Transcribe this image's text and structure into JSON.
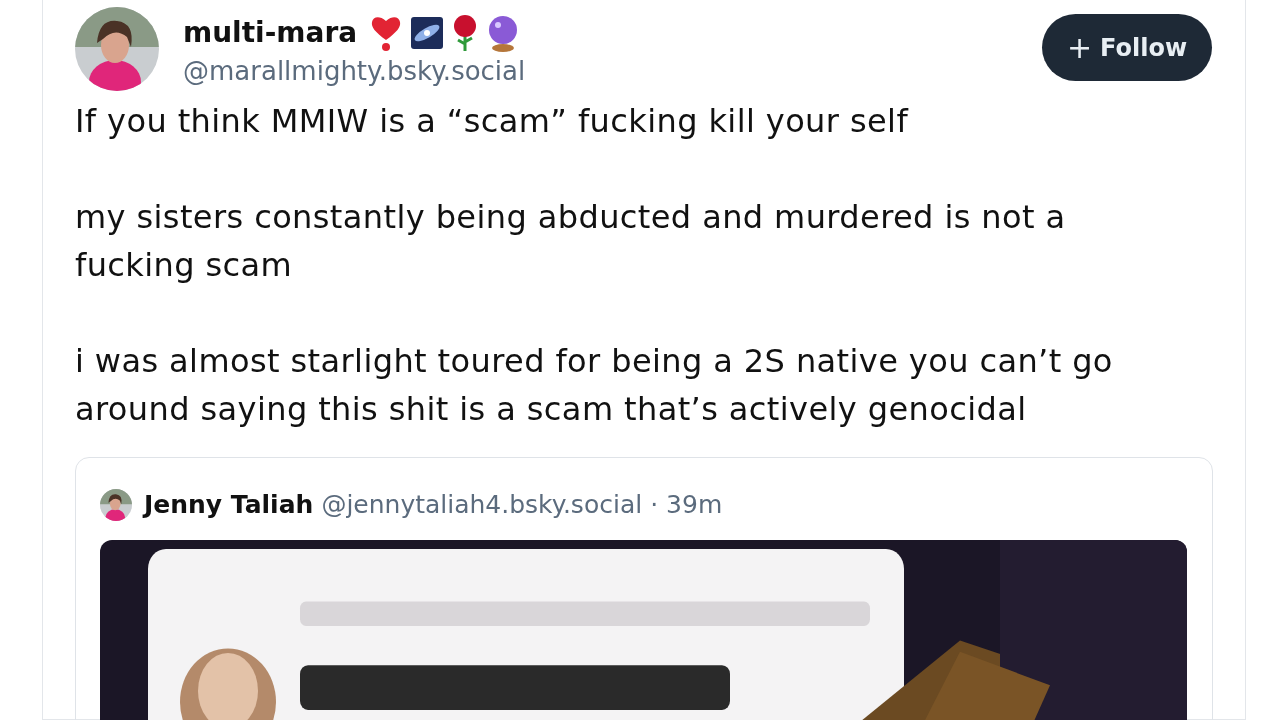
{
  "post": {
    "author": {
      "display_name": "multi-mara",
      "handle": "@marallmighty.bsky.social"
    },
    "follow_button": {
      "icon": "+",
      "label": "Follow"
    },
    "paragraphs": [
      "If you think MMIW is a “scam” fucking kill your self",
      "my sisters constantly being abducted and murdered is not a fucking scam",
      "i was almost starlight toured for being a 2S native you can’t go around saying this shit is a scam that’s actively genocidal"
    ],
    "quote": {
      "author": {
        "display_name": "Jenny Taliah",
        "handle": "@jennytaliah4.bsky.social",
        "separator": "·",
        "time": "39m"
      }
    }
  }
}
